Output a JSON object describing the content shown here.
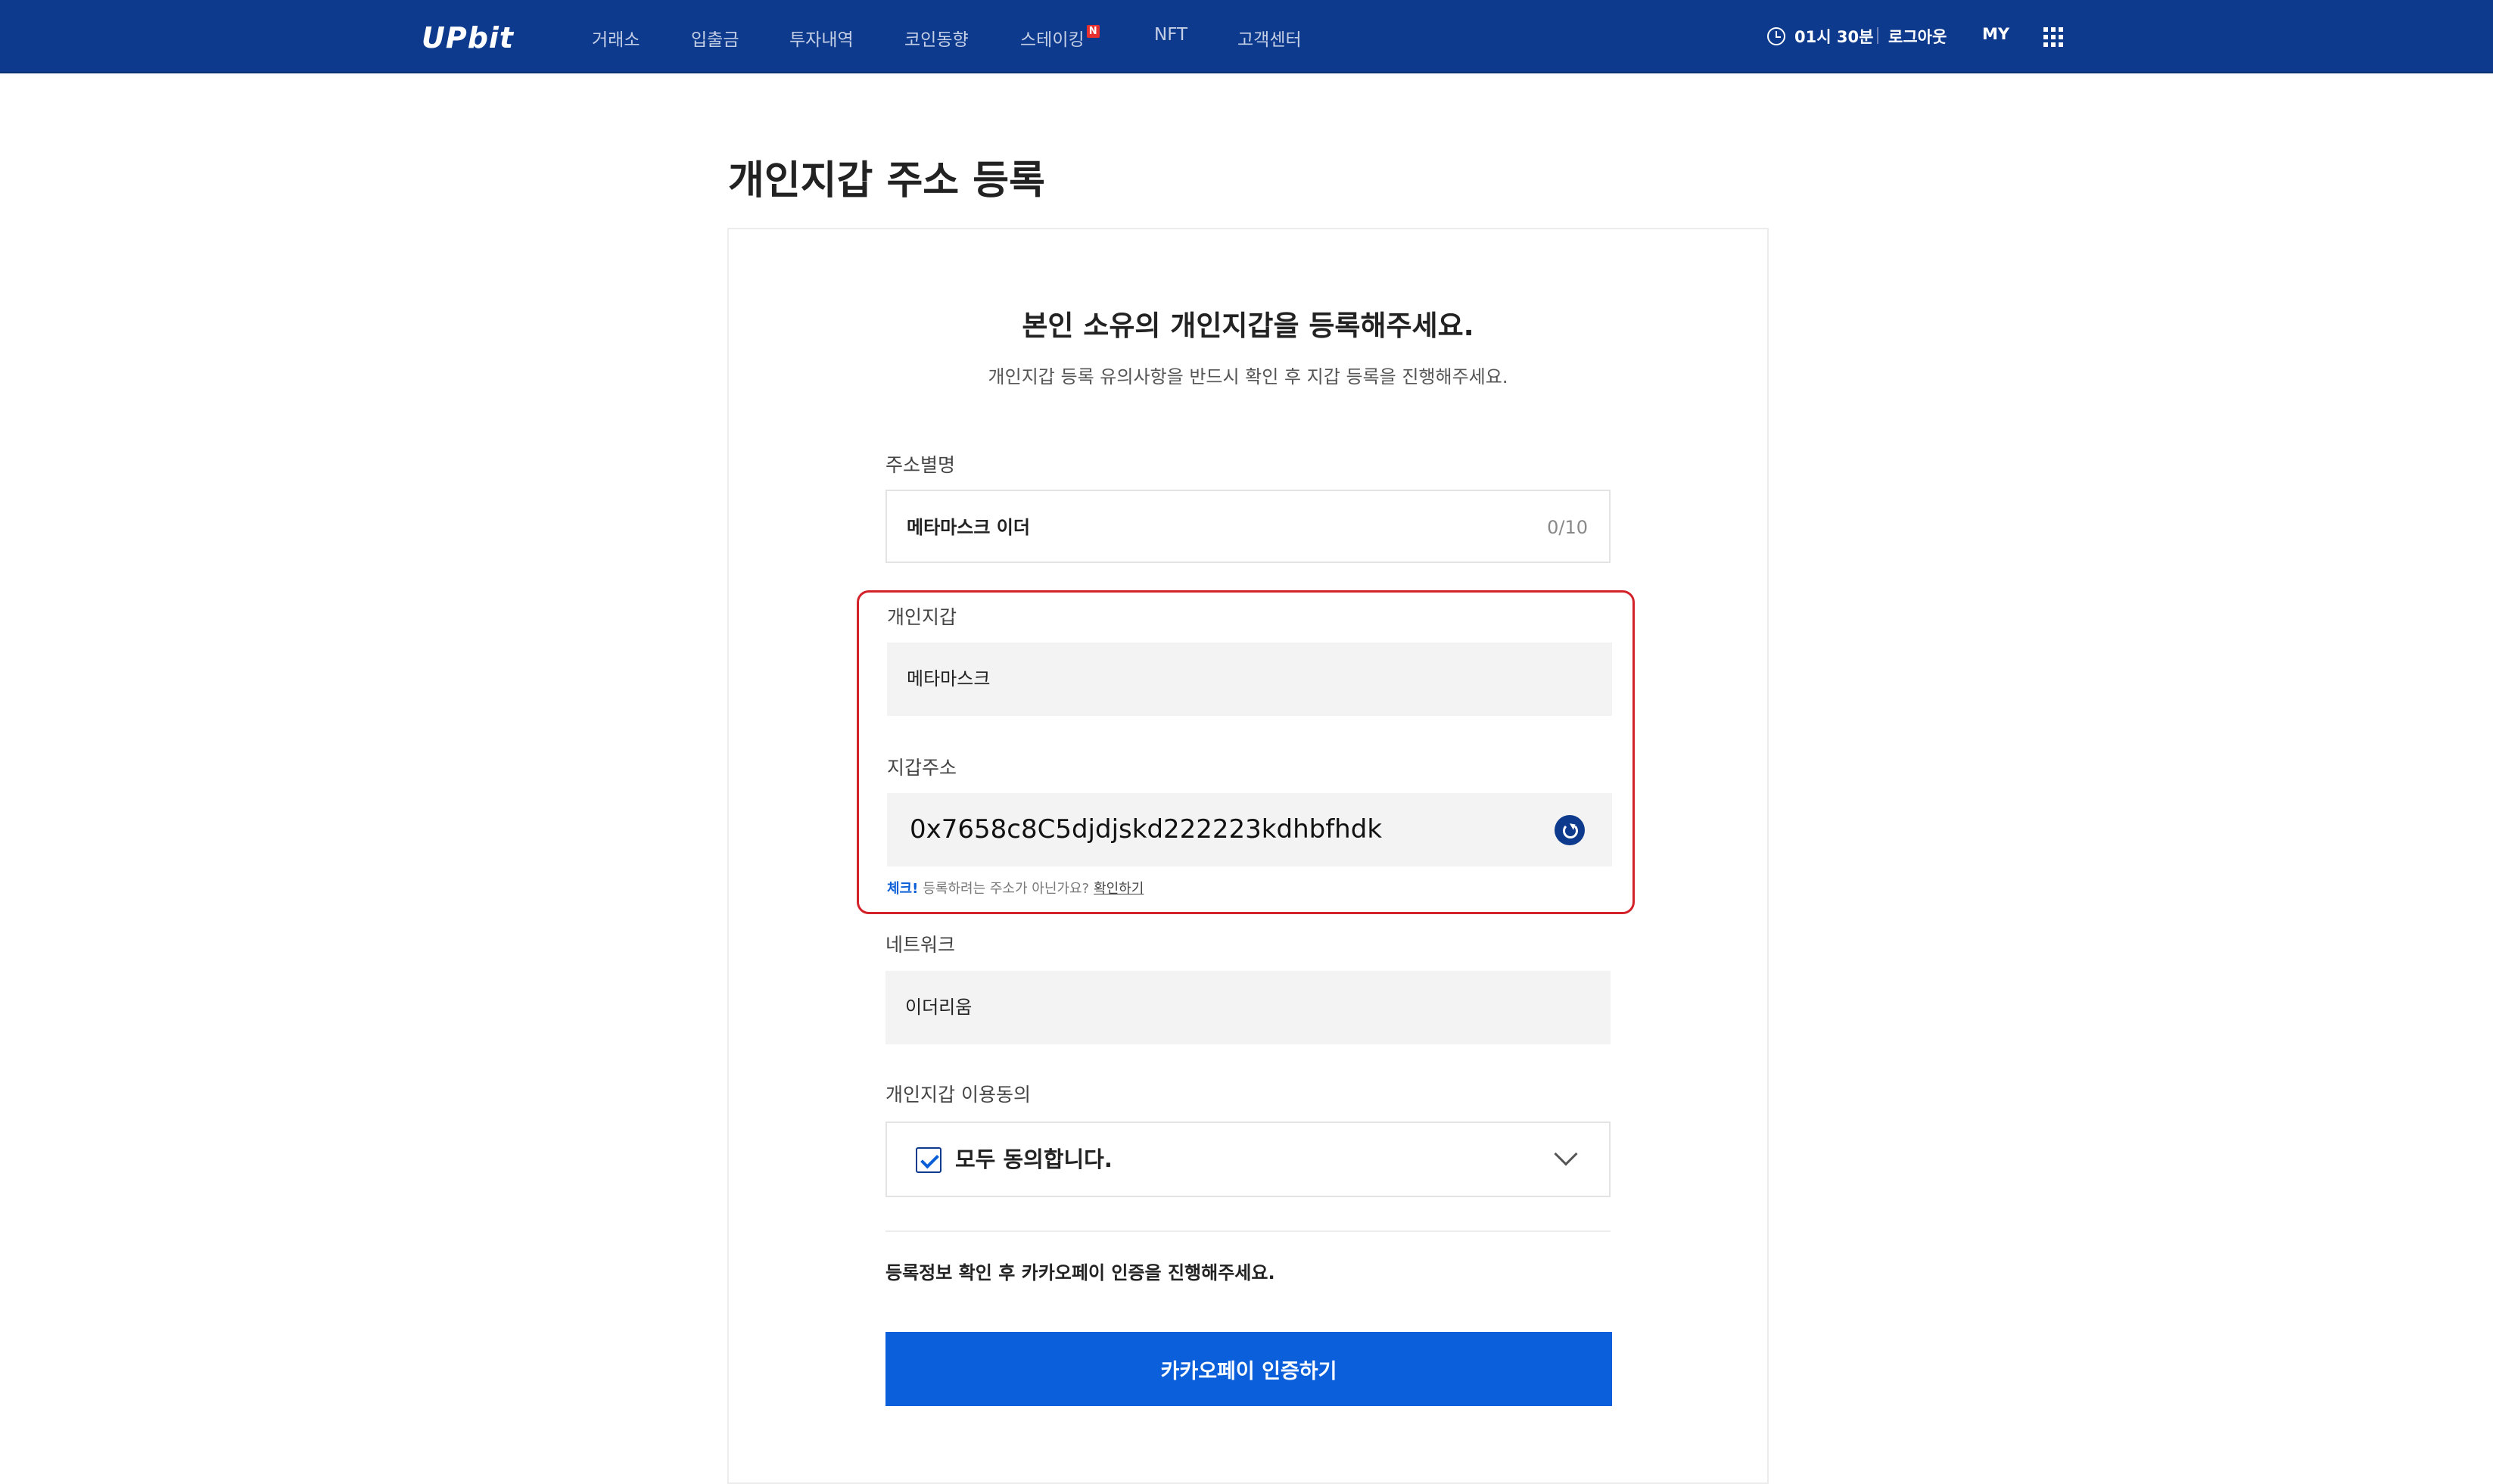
{
  "header": {
    "logo": "UPbit",
    "nav": [
      "거래소",
      "입출금",
      "투자내역",
      "코인동향",
      "스테이킹",
      "NFT",
      "고객센터"
    ],
    "nav_badge": "N",
    "timer": "01시 30분",
    "logout": "로그아웃",
    "my": "MY",
    "colors": {
      "bar": "#0d3a8c",
      "badge": "#e8312f"
    }
  },
  "page": {
    "title": "개인지갑 주소 등록",
    "heading": "본인 소유의 개인지갑을 등록해주세요.",
    "subheading": "개인지갑 등록 유의사항을 반드시 확인 후 지갑 등록을 진행해주세요."
  },
  "form": {
    "alias": {
      "label": "주소별명",
      "value": "메타마스크 이더",
      "counter": "0/10"
    },
    "wallet": {
      "label": "개인지갑",
      "value": "메타마스크"
    },
    "address": {
      "label": "지갑주소",
      "value": "0x7658c8C5djdjskd222223kdhbfhdk",
      "check_strong": "체크!",
      "check_text": "등록하려는 주소가 아닌가요?",
      "check_link": "확인하기"
    },
    "network": {
      "label": "네트워크",
      "value": "이더리움"
    },
    "consent": {
      "label": "개인지갑 이용동의",
      "value": "모두 동의합니다.",
      "checked": true
    },
    "notice": "등록정보 확인 후 카카오페이 인증을 진행해주세요.",
    "submit": "카카오페이 인증하기",
    "colors": {
      "button": "#0b5fdb",
      "highlight": "#d3222a"
    }
  }
}
